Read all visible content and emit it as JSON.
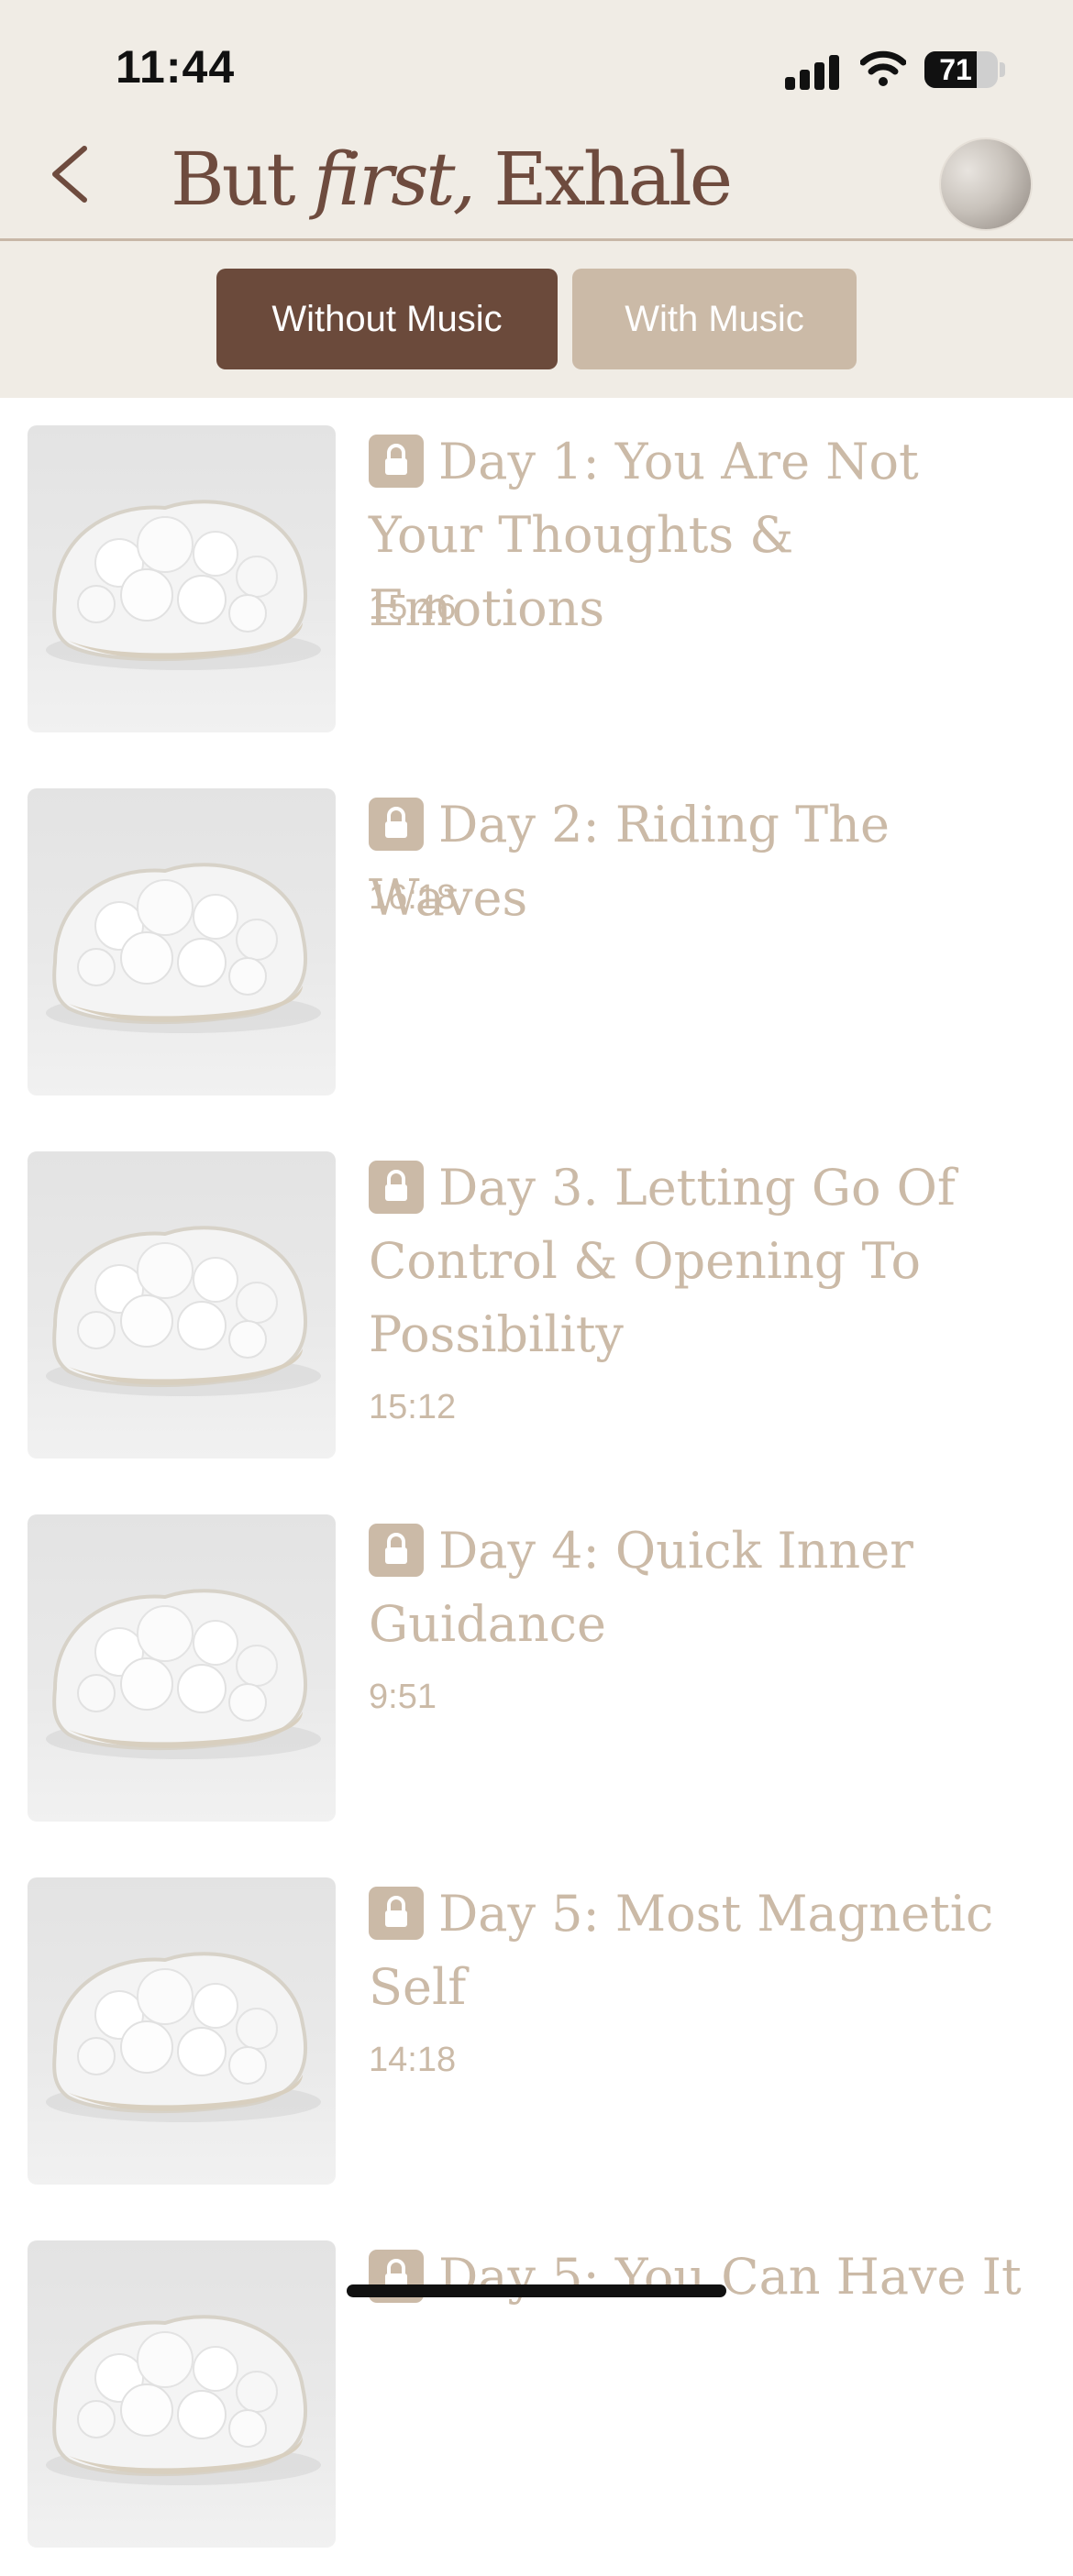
{
  "status_bar": {
    "time": "11:44",
    "battery": "71"
  },
  "header": {
    "logo_prefix": "But ",
    "logo_italic": "first,",
    "logo_suffix": " Exhale"
  },
  "toggle": {
    "without_music": "Without Music",
    "with_music": "With Music",
    "selected": "Without Music"
  },
  "episodes": [
    {
      "title": "Day 1: You Are Not Your Thoughts & Emotions",
      "duration": "15:46",
      "locked": true
    },
    {
      "title": "Day 2: Riding The Waves",
      "duration": "16:18",
      "locked": true
    },
    {
      "title": "Day 3. Letting Go Of Control & Opening To Possibility",
      "duration": "15:12",
      "locked": true
    },
    {
      "title": "Day 4: Quick Inner Guidance",
      "duration": "9:51",
      "locked": true
    },
    {
      "title": "Day 5: Most Magnetic Self",
      "duration": "14:18",
      "locked": true
    },
    {
      "title": "Day 5: You Can Have It",
      "duration": "",
      "locked": true
    }
  ],
  "colors": {
    "accent": "#6b4a3b",
    "muted": "#cbbaa7",
    "header_bg": "#f0ece5"
  }
}
